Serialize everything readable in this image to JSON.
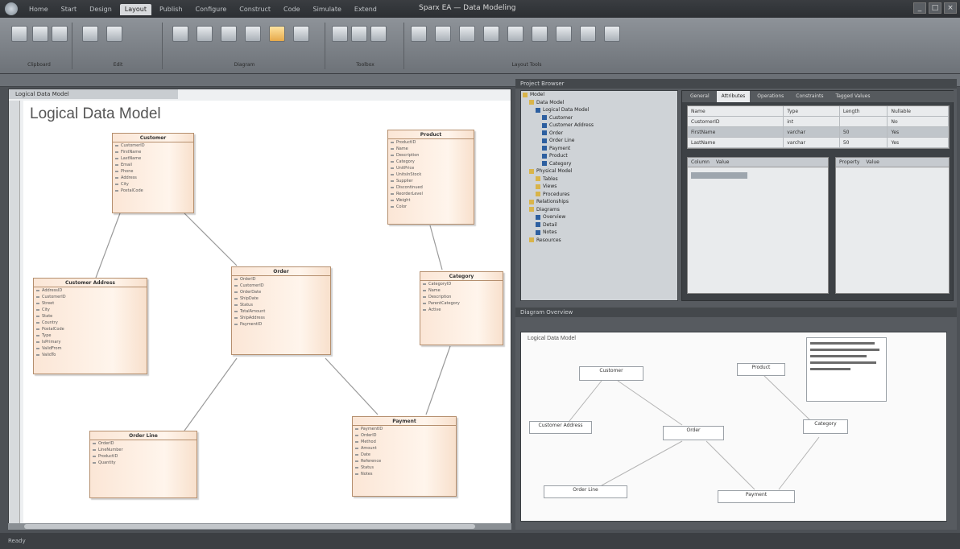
{
  "window": {
    "title": "Sparx EA — Data Modeling",
    "tabs": [
      "Home",
      "Start",
      "Design",
      "Layout",
      "Publish",
      "Configure",
      "Construct",
      "Code",
      "Simulate",
      "Extend"
    ],
    "active_tab_index": 3,
    "controls": [
      "_",
      "□",
      "×"
    ]
  },
  "ribbon": {
    "groups": [
      {
        "title": "Clipboard",
        "buttons": [
          "",
          "",
          ""
        ]
      },
      {
        "title": "Edit",
        "buttons": [
          "",
          ""
        ]
      },
      {
        "title": "Diagram",
        "buttons": [
          "",
          "",
          "",
          "",
          "",
          ""
        ]
      },
      {
        "title": "Toolbox",
        "buttons": [
          "",
          "",
          "",
          ""
        ]
      },
      {
        "title": "Layout Tools",
        "buttons": [
          "",
          "",
          "",
          "",
          "",
          "",
          "",
          "",
          ""
        ]
      }
    ]
  },
  "left_doc": {
    "tab_label": "Logical Data Model",
    "title": "Logical Data Model",
    "entities": [
      {
        "name": "Customer",
        "rows": [
          "CustomerID",
          "FirstName",
          "LastName",
          "Email",
          "Phone",
          "Address",
          "City",
          "PostalCode"
        ]
      },
      {
        "name": "Product",
        "rows": [
          "ProductID",
          "Name",
          "Description",
          "Category",
          "UnitPrice",
          "UnitsInStock",
          "Supplier",
          "Discontinued",
          "ReorderLevel",
          "Weight",
          "Color"
        ]
      },
      {
        "name": "Customer Address",
        "rows": [
          "AddressID",
          "CustomerID",
          "Street",
          "City",
          "State",
          "Country",
          "PostalCode",
          "Type",
          "IsPrimary",
          "ValidFrom",
          "ValidTo"
        ]
      },
      {
        "name": "Order",
        "rows": [
          "OrderID",
          "CustomerID",
          "OrderDate",
          "ShipDate",
          "Status",
          "TotalAmount",
          "ShipAddress",
          "PaymentID"
        ]
      },
      {
        "name": "Category",
        "rows": [
          "CategoryID",
          "Name",
          "Description",
          "ParentCategory",
          "Active"
        ]
      },
      {
        "name": "Order Line",
        "rows": [
          "OrderID",
          "LineNumber",
          "ProductID",
          "Quantity"
        ]
      },
      {
        "name": "Payment",
        "rows": [
          "PaymentID",
          "OrderID",
          "Method",
          "Amount",
          "Date",
          "Reference",
          "Status",
          "Notes"
        ]
      }
    ]
  },
  "tree": {
    "header": "Project Browser",
    "items": [
      {
        "label": "Model",
        "kind": "fold",
        "indent": 0
      },
      {
        "label": "Data Model",
        "kind": "fold",
        "indent": 1
      },
      {
        "label": "Logical Data Model",
        "kind": "item",
        "indent": 2
      },
      {
        "label": "Customer",
        "kind": "item",
        "indent": 3
      },
      {
        "label": "Customer Address",
        "kind": "item",
        "indent": 3
      },
      {
        "label": "Order",
        "kind": "item",
        "indent": 3
      },
      {
        "label": "Order Line",
        "kind": "item",
        "indent": 3
      },
      {
        "label": "Payment",
        "kind": "item",
        "indent": 3
      },
      {
        "label": "Product",
        "kind": "item",
        "indent": 3
      },
      {
        "label": "Category",
        "kind": "item",
        "indent": 3
      },
      {
        "label": "Physical Model",
        "kind": "fold",
        "indent": 1
      },
      {
        "label": "Tables",
        "kind": "fold",
        "indent": 2
      },
      {
        "label": "Views",
        "kind": "fold",
        "indent": 2
      },
      {
        "label": "Procedures",
        "kind": "fold",
        "indent": 2
      },
      {
        "label": "Relationships",
        "kind": "fold",
        "indent": 1
      },
      {
        "label": "Diagrams",
        "kind": "fold",
        "indent": 1
      },
      {
        "label": "Overview",
        "kind": "item",
        "indent": 2
      },
      {
        "label": "Detail",
        "kind": "item",
        "indent": 2
      },
      {
        "label": "Notes",
        "kind": "item",
        "indent": 2
      },
      {
        "label": "Resources",
        "kind": "fold",
        "indent": 1
      }
    ]
  },
  "properties": {
    "tabs": [
      "General",
      "Attributes",
      "Operations",
      "Constraints",
      "Tagged Values"
    ],
    "active_tab_index": 1,
    "rows": [
      {
        "cells": [
          "Name",
          "Type",
          "Length",
          "Nullable"
        ]
      },
      {
        "cells": [
          "CustomerID",
          "int",
          "",
          "No"
        ]
      },
      {
        "cells": [
          "FirstName",
          "varchar",
          "50",
          "Yes"
        ]
      },
      {
        "cells": [
          "LastName",
          "varchar",
          "50",
          "Yes"
        ]
      }
    ],
    "grid_left_headers": [
      "Column",
      "Value"
    ],
    "grid_right_headers": [
      "Property",
      "Value"
    ]
  },
  "preview": {
    "header": "Diagram Overview",
    "title": "Logical Data Model",
    "boxes": [
      "Customer",
      "Product",
      "Customer Address",
      "Order",
      "Category",
      "Order Line",
      "Payment"
    ]
  },
  "status": "Ready"
}
